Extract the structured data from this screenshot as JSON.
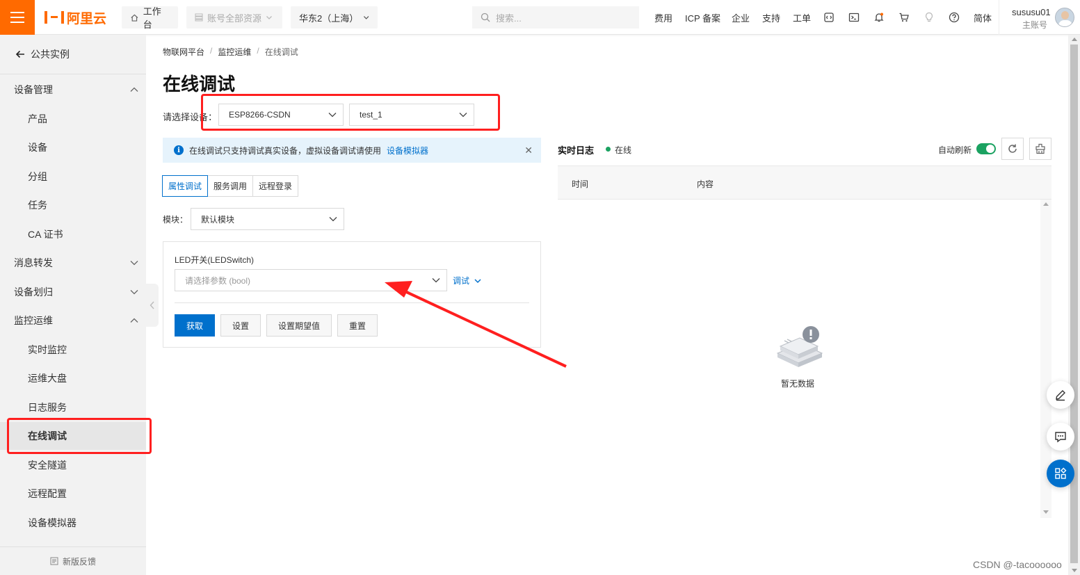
{
  "topbar": {
    "logo_text": "阿里云",
    "workbench": "工作台",
    "account_resources": "账号全部资源",
    "region": "华东2（上海）",
    "search_placeholder": "搜索...",
    "nav": [
      "费用",
      "ICP 备案",
      "企业",
      "支持",
      "工单"
    ],
    "lang": "简体",
    "user_name": "sususu01",
    "user_role": "主账号",
    "icons": [
      "code-icon",
      "terminal-icon",
      "bell-icon",
      "cart-icon",
      "bulb-icon",
      "help-icon"
    ],
    "accent": "#ff6a00"
  },
  "sidebar": {
    "back_label": "公共实例",
    "items": [
      {
        "label": "设备管理",
        "type": "group",
        "expanded": true
      },
      {
        "label": "产品",
        "type": "sub"
      },
      {
        "label": "设备",
        "type": "sub"
      },
      {
        "label": "分组",
        "type": "sub"
      },
      {
        "label": "任务",
        "type": "sub"
      },
      {
        "label": "CA 证书",
        "type": "sub"
      },
      {
        "label": "消息转发",
        "type": "group",
        "expanded": false
      },
      {
        "label": "设备划归",
        "type": "group",
        "expanded": false
      },
      {
        "label": "监控运维",
        "type": "group",
        "expanded": true
      },
      {
        "label": "实时监控",
        "type": "sub"
      },
      {
        "label": "运维大盘",
        "type": "sub"
      },
      {
        "label": "日志服务",
        "type": "sub"
      },
      {
        "label": "在线调试",
        "type": "sub",
        "active": true
      },
      {
        "label": "安全隧道",
        "type": "sub"
      },
      {
        "label": "远程配置",
        "type": "sub"
      },
      {
        "label": "设备模拟器",
        "type": "sub"
      }
    ],
    "feedback": "新版反馈"
  },
  "main": {
    "breadcrumb": [
      "物联网平台",
      "监控运维",
      "在线调试"
    ],
    "title": "在线调试",
    "device_label": "请选择设备：",
    "product_select": "ESP8266-CSDN",
    "device_select": "test_1",
    "alert_text": "在线调试只支持调试真实设备，虚拟设备调试请使用",
    "alert_link": "设备模拟器",
    "tabs": [
      "属性调试",
      "服务调用",
      "远程登录"
    ],
    "module_label": "模块：",
    "module_select": "默认模块",
    "property_name": "LED开关(LEDSwitch)",
    "param_placeholder": "请选择参数 (bool)",
    "debug_link": "调试",
    "buttons": [
      "获取",
      "设置",
      "设置期望值",
      "重置"
    ]
  },
  "log": {
    "title": "实时日志",
    "status": "在线",
    "status_color": "#1ba261",
    "auto_refresh": "自动刷新",
    "auto_refresh_on": true,
    "col_time": "时间",
    "col_content": "内容",
    "empty": "暂无数据"
  },
  "watermark": "CSDN @-tacoooooo",
  "annotation_color": "#ff1f1f"
}
